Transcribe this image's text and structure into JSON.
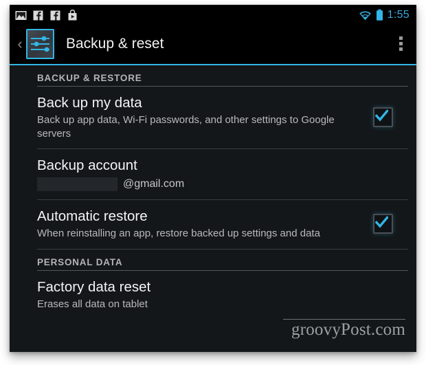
{
  "status_bar": {
    "notification_icons": [
      {
        "name": "gallery-photo-icon",
        "label": "Gallery"
      },
      {
        "name": "facebook-icon",
        "label": "Facebook"
      },
      {
        "name": "facebook-icon-2",
        "label": "Facebook"
      },
      {
        "name": "play-store-bag-icon",
        "label": "Play Store"
      }
    ],
    "wifi_icon": "wifi-icon",
    "battery_icon": "battery-icon",
    "clock": "1:55",
    "accent_color": "#33b5e5"
  },
  "action_bar": {
    "back_chevron": "‹",
    "app_icon": "settings-sliders-icon",
    "title": "Backup & reset",
    "overflow_menu": "overflow-menu-icon"
  },
  "sections": [
    {
      "header": "BACKUP & RESTORE",
      "items": [
        {
          "title": "Back up my data",
          "summary": "Back up app data, Wi-Fi passwords, and other settings to Google servers",
          "control": "checkbox",
          "checked": true
        },
        {
          "title": "Backup account",
          "account_redacted": "",
          "account_domain": "@gmail.com",
          "control": "none"
        },
        {
          "title": "Automatic restore",
          "summary": "When reinstalling an app, restore backed up settings and data",
          "control": "checkbox",
          "checked": true
        }
      ]
    },
    {
      "header": "PERSONAL DATA",
      "items": [
        {
          "title": "Factory data reset",
          "summary": "Erases all data on tablet",
          "control": "none"
        }
      ]
    }
  ],
  "watermark": {
    "text": "groovyPost.com"
  },
  "colors": {
    "accent": "#33b5e5",
    "content_background": "#14171a",
    "bar_background": "#000000",
    "primary_text": "#f4f4f4",
    "secondary_text": "#b9b9b9"
  }
}
